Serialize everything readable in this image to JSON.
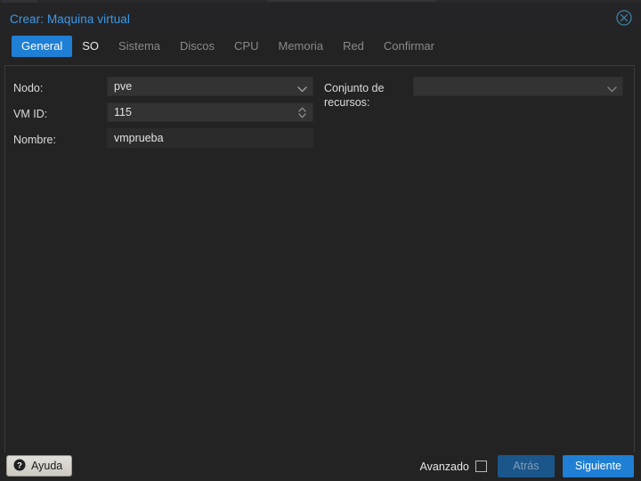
{
  "dialog": {
    "title": "Crear: Maquina virtual",
    "close_icon": "close-circle-icon",
    "tabs": [
      {
        "label": "General",
        "state": "active"
      },
      {
        "label": "SO",
        "state": "enabled"
      },
      {
        "label": "Sistema",
        "state": "disabled"
      },
      {
        "label": "Discos",
        "state": "disabled"
      },
      {
        "label": "CPU",
        "state": "disabled"
      },
      {
        "label": "Memoria",
        "state": "disabled"
      },
      {
        "label": "Red",
        "state": "disabled"
      },
      {
        "label": "Confirmar",
        "state": "disabled"
      }
    ]
  },
  "form": {
    "left": {
      "nodo": {
        "label": "Nodo:",
        "value": "pve",
        "icon": "chevron-down-icon"
      },
      "vmid": {
        "label": "VM ID:",
        "value": "115",
        "icon": "spinner-updown-icon"
      },
      "nombre": {
        "label": "Nombre:",
        "value": "vmprueba",
        "placeholder": ""
      }
    },
    "right": {
      "conjunto": {
        "label": "Conjunto de\nrecursos:",
        "value": "",
        "placeholder": "",
        "icon": "chevron-down-icon"
      }
    }
  },
  "footer": {
    "help_label": "Ayuda",
    "help_icon": "question-mark-circle-icon",
    "advanced_label": "Avanzado",
    "advanced_checked": false,
    "back_label": "Atrás",
    "next_label": "Siguiente"
  },
  "colors": {
    "accent": "#1f7fd4",
    "title": "#3c9ae8",
    "window_bg": "#232323",
    "field_bg": "#333333",
    "help_btn_bg": "#d4d0c8"
  }
}
